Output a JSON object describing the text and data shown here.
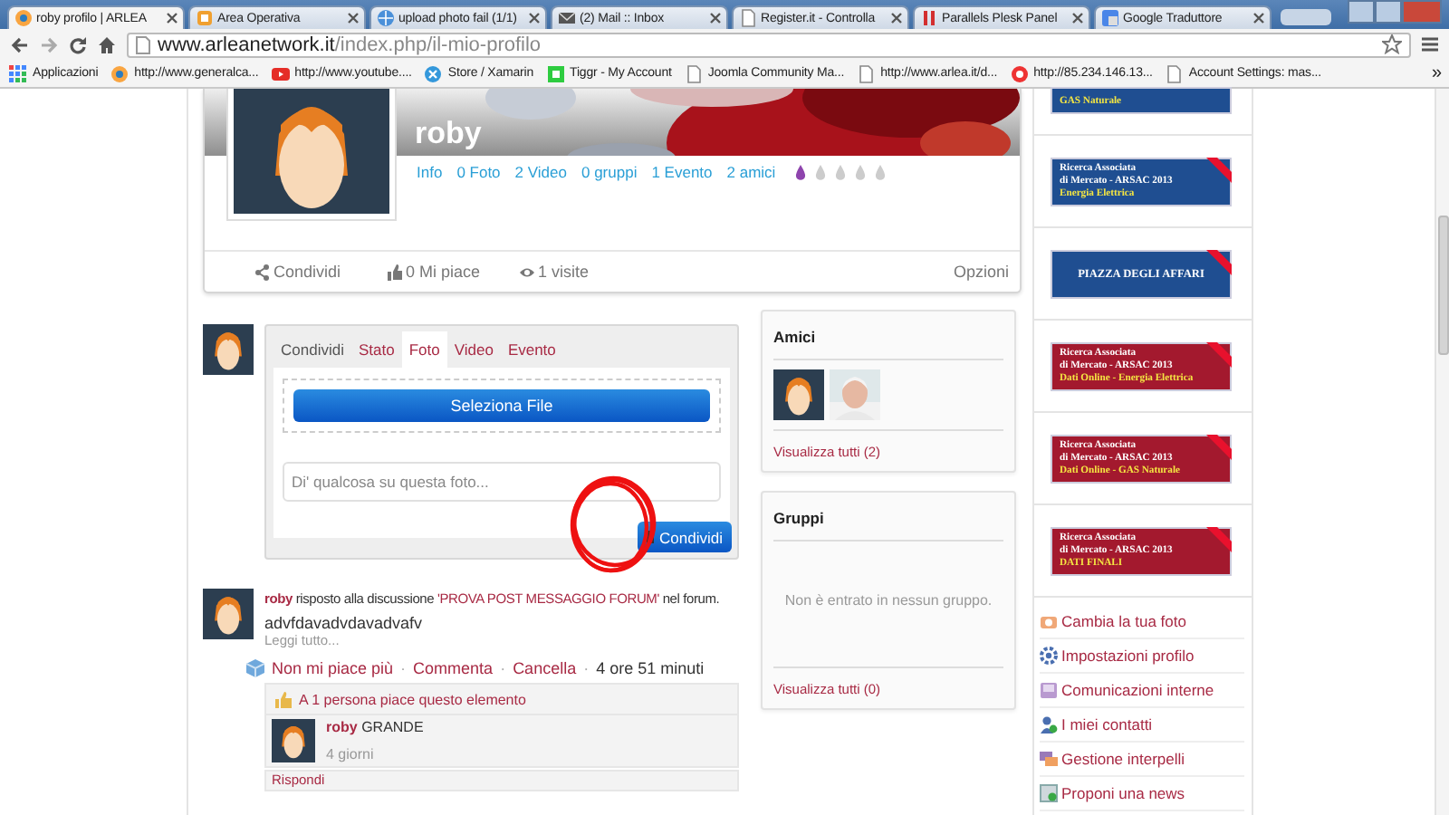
{
  "browser": {
    "tabs": [
      {
        "title": "roby profilo | ARLEA",
        "kind": "joomla",
        "selected": true
      },
      {
        "title": "Area Operativa",
        "kind": "orange",
        "selected": false
      },
      {
        "title": "upload photo fail (1/1)",
        "kind": "globe",
        "selected": false
      },
      {
        "title": "(2) Mail :: Inbox",
        "kind": "mail",
        "selected": false
      },
      {
        "title": "Register.it - Controlla",
        "kind": "page",
        "selected": false
      },
      {
        "title": "Parallels Plesk Panel",
        "kind": "plesk",
        "selected": false
      },
      {
        "title": "Google Traduttore",
        "kind": "translate",
        "selected": false
      }
    ],
    "url_domain": "www.arleanetwork.it",
    "url_path": "/index.php/il-mio-profilo",
    "bookmarks": [
      {
        "label": "Applicazioni",
        "kind": "apps"
      },
      {
        "label": "http://www.generalca...",
        "kind": "joomla"
      },
      {
        "label": "http://www.youtube....",
        "kind": "youtube"
      },
      {
        "label": "Store / Xamarin",
        "kind": "xamarin"
      },
      {
        "label": "Tiggr - My Account",
        "kind": "tiggr"
      },
      {
        "label": "Joomla Community Ma...",
        "kind": "page"
      },
      {
        "label": "http://www.arlea.it/d...",
        "kind": "page"
      },
      {
        "label": "http://85.234.146.13...",
        "kind": "red"
      },
      {
        "label": "Account Settings: mas...",
        "kind": "page"
      }
    ],
    "more_bookmarks": "»"
  },
  "profile": {
    "name": "roby",
    "links": [
      "Info",
      "0 Foto",
      "2 Video",
      "0 gruppi",
      "1 Evento",
      "2 amici"
    ],
    "rating": {
      "stars": 1
    },
    "actions": [
      {
        "label": "Condividi",
        "kind": "share"
      },
      {
        "label": "0 Mi piace",
        "kind": "like"
      },
      {
        "label": "1 visite",
        "kind": "views"
      }
    ],
    "options": "Opzioni"
  },
  "composer": {
    "tabs": [
      {
        "label": "Condividi",
        "selected": false
      },
      {
        "label": "Stato",
        "selected": false
      },
      {
        "label": "Foto",
        "selected": true
      },
      {
        "label": "Video",
        "selected": false
      },
      {
        "label": "Evento",
        "selected": false
      }
    ],
    "select_file": "Seleziona File",
    "placeholder": "Di' qualcosa su questa foto...",
    "submit": "Condividi"
  },
  "activity": {
    "author": "roby",
    "action": "risposto alla discussione",
    "topic": "'PROVA POST MESSAGGIO FORUM'",
    "suffix": "nel forum.",
    "excerpt": "advfdavadvdavadvafv",
    "read_more": "Leggi tutto...",
    "actions": [
      {
        "label": "Non mi piace più",
        "kind": "link"
      },
      {
        "label": "·",
        "kind": "separator"
      },
      {
        "label": "Commenta",
        "kind": "link"
      },
      {
        "label": "·",
        "kind": "separator"
      },
      {
        "label": "Cancella",
        "kind": "link"
      },
      {
        "label": "·",
        "kind": "separator"
      },
      {
        "label": "4 ore 51 minuti",
        "kind": "time"
      }
    ],
    "likes": "A 1 persona piace questo elemento",
    "comment": {
      "author": "roby",
      "text": "GRANDE",
      "time": "4 giorni"
    },
    "reply": "Rispondi"
  },
  "friends": {
    "title": "Amici",
    "members": [
      {
        "kind": "avatar"
      },
      {
        "kind": "picture"
      }
    ],
    "view_all": "Visualizza tutti (2)"
  },
  "groups": {
    "title": "Gruppi",
    "empty": "Non è entrato in nessun gruppo.",
    "view_all": "Visualizza tutti (0)"
  },
  "banners": [
    {
      "color": "#1f4e91",
      "highlight": "GAS Naturale"
    },
    {
      "color": "#1f4e91",
      "lines": [
        "Ricerca Associata",
        "di Mercato - ARSAC 2013"
      ],
      "highlight": "Energia Elettrica"
    },
    {
      "color": "#1f4e91",
      "title": "PIAZZA DEGLI AFFARI"
    },
    {
      "color": "#a3192e",
      "lines": [
        "Ricerca Associata",
        "di Mercato - ARSAC 2013"
      ],
      "highlight": "Dati Online - Energia Elettrica"
    },
    {
      "color": "#a3192e",
      "lines": [
        "Ricerca Associata",
        "di Mercato - ARSAC 2013"
      ],
      "highlight": "Dati Online - GAS Naturale"
    },
    {
      "color": "#a3192e",
      "lines": [
        "Ricerca Associata",
        "di Mercato - ARSAC 2013"
      ],
      "highlight": "DATI FINALI"
    }
  ],
  "menu": [
    {
      "label": "Cambia la tua foto",
      "kind": "camera"
    },
    {
      "label": "Impostazioni profilo",
      "kind": "gear"
    },
    {
      "label": "Comunicazioni interne",
      "kind": "inbox"
    },
    {
      "label": "I miei contatti",
      "kind": "contact"
    },
    {
      "label": "Gestione interpelli",
      "kind": "chat"
    },
    {
      "label": "Proponi una news",
      "kind": "news"
    }
  ]
}
